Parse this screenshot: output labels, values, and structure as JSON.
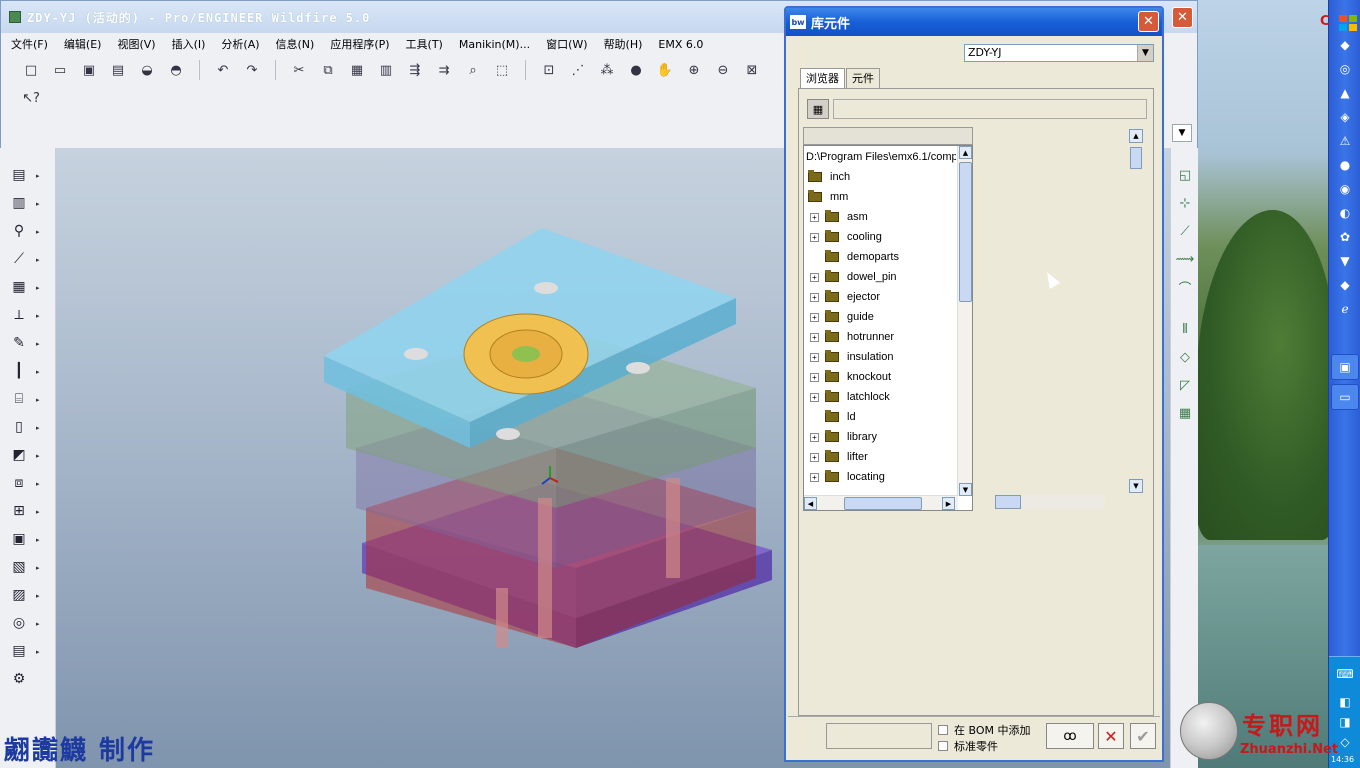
{
  "main_window": {
    "title": "ZDY-YJ (活动的) - Pro/ENGINEER Wildfire 5.0",
    "close_glyph": "✕",
    "menu": [
      "文件(F)",
      "编辑(E)",
      "视图(V)",
      "插入(I)",
      "分析(A)",
      "信息(N)",
      "应用程序(P)",
      "工具(T)",
      "Manikin(M)...",
      "窗口(W)",
      "帮助(H)",
      "EMX 6.0"
    ],
    "toolbar_icons": [
      "new-icon",
      "open-icon",
      "save-icon",
      "print-icon",
      "send-icon",
      "erase-icon",
      "undo-icon",
      "redo-icon",
      "cut-icon",
      "copy-icon",
      "paste-icon",
      "paste-special-icon",
      "regenerate-icon",
      "regen-manager-icon",
      "find-icon",
      "select-box-icon",
      "datum-display-icon",
      "axis-display-icon",
      "point-display-icon",
      "shade-icon",
      "pan-icon",
      "zoom-in-icon",
      "zoom-out-icon",
      "refit-icon"
    ],
    "help_icon": "context-help-icon"
  },
  "watermark": "翽讟鱴 制作",
  "dialog": {
    "title": "库元件",
    "title_icon_text": "bw",
    "close_glyph": "✕",
    "library_select": "ZDY-YJ",
    "tabs": [
      "浏览器",
      "元件"
    ],
    "active_tab": "浏览器",
    "tree_path": "D:\\Program Files\\emx6.1/comp",
    "tree_items": [
      {
        "label": "inch",
        "level": 0,
        "expand": false
      },
      {
        "label": "mm",
        "level": 0,
        "expand": false
      },
      {
        "label": "asm",
        "level": 1,
        "expand": true
      },
      {
        "label": "cooling",
        "level": 1,
        "expand": true
      },
      {
        "label": "demoparts",
        "level": 1,
        "expand": false
      },
      {
        "label": "dowel_pin",
        "level": 1,
        "expand": true
      },
      {
        "label": "ejector",
        "level": 1,
        "expand": true
      },
      {
        "label": "guide",
        "level": 1,
        "expand": true
      },
      {
        "label": "hotrunner",
        "level": 1,
        "expand": true
      },
      {
        "label": "insulation",
        "level": 1,
        "expand": true
      },
      {
        "label": "knockout",
        "level": 1,
        "expand": true
      },
      {
        "label": "latchlock",
        "level": 1,
        "expand": true
      },
      {
        "label": "ld",
        "level": 1,
        "expand": false
      },
      {
        "label": "library",
        "level": 1,
        "expand": true
      },
      {
        "label": "lifter",
        "level": 1,
        "expand": true
      },
      {
        "label": "locating",
        "level": 1,
        "expand": true
      }
    ],
    "bom_label_1": "在 BOM 中添加",
    "bom_label_2": "标准零件",
    "glasses_glyph": "ꝏ",
    "cancel_glyph": "✕",
    "ok_glyph": "✔"
  },
  "branding": {
    "logo_text": "专职网",
    "logo_url": "Zhuanzhi.Net",
    "clock": "14:36"
  },
  "colors": {
    "xp_title_blue": "#1760d8",
    "close_red": "#d65a3a",
    "watermark_blue": "#1d3aa0",
    "logo_red": "#c81818"
  }
}
